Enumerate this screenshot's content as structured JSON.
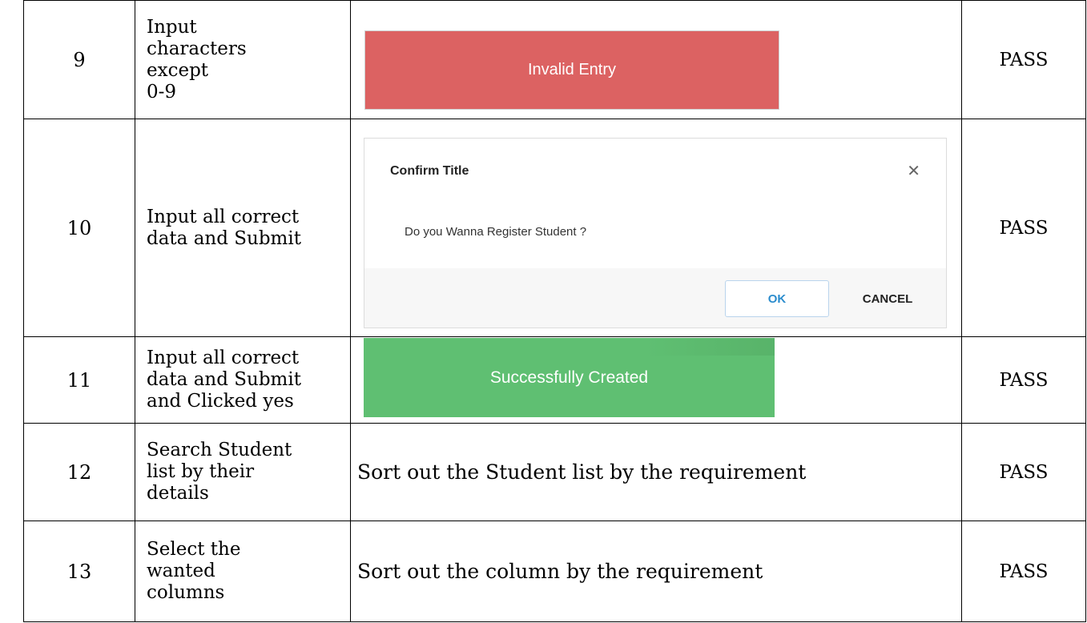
{
  "rows": [
    {
      "no": "9",
      "description": "Input\ncharacters\nexcept\n0-9",
      "result": "PASS"
    },
    {
      "no": "10",
      "description": "Input all correct\ndata and Submit",
      "result": "PASS"
    },
    {
      "no": "11",
      "description": "Input all correct\ndata and Submit\nand Clicked yes",
      "result": "PASS"
    },
    {
      "no": "12",
      "description": "Search  Student\nlist by their\ndetails",
      "expected": "Sort out the  Student list by the requirement",
      "result": "PASS"
    },
    {
      "no": "13",
      "description": "Select the\nwanted\ncolumns",
      "expected": "Sort out the column by the requirement",
      "result": "PASS"
    }
  ],
  "error_banner": {
    "text": "Invalid Entry",
    "color": "#dc6262"
  },
  "confirm_dialog": {
    "title": "Confirm Title",
    "close_icon": "close-icon",
    "message": "Do you Wanna Register Student ?",
    "ok_label": "OK",
    "cancel_label": "CANCEL"
  },
  "success_banner": {
    "text": "Successfully Created",
    "color": "#5fbf72"
  }
}
